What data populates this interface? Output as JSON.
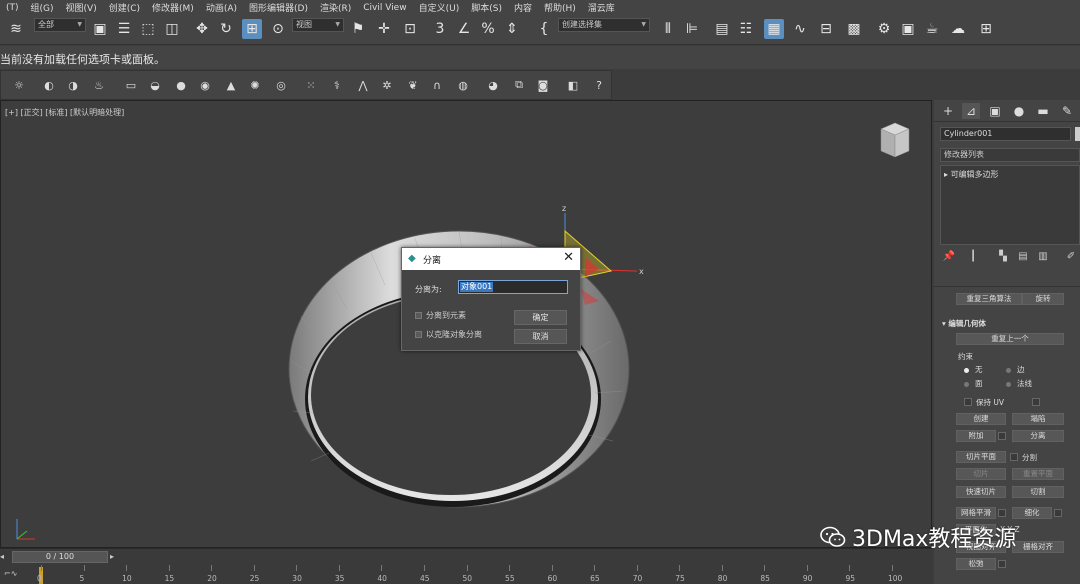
{
  "menu": [
    "(T)",
    "组(G)",
    "视图(V)",
    "创建(C)",
    "修改器(M)",
    "动画(A)",
    "图形编辑器(D)",
    "渲染(R)",
    "Civil View",
    "自定义(U)",
    "脚本(S)",
    "内容",
    "帮助(H)",
    "溜云库"
  ],
  "toolbar": {
    "filter_combo": "全部",
    "viewport_combo": "视图",
    "selection_set_combo": "创建选择集"
  },
  "status_message": "当前没有加载任何选项卡或面板。",
  "viewport": {
    "label": "[+] [正交] [标准] [默认明暗处理]",
    "gizmo_x": "x",
    "gizmo_z": "z"
  },
  "dialog": {
    "title": "分离",
    "detach_as_label": "分离为:",
    "detach_as_value": "对象001",
    "option_element": "分离到元素",
    "option_clone": "以克隆对象分离",
    "ok_label": "确定",
    "cancel_label": "取消"
  },
  "command_panel": {
    "object_name": "Cylinder001",
    "modifier_list": "修改器列表",
    "stack_item": "可编辑多边形",
    "retriangulate": "重复三角算法",
    "rotate": "旋转",
    "section_title": "编辑几何体",
    "repeat_last": "重复上一个",
    "constraints_title": "约束",
    "constraint_none": "无",
    "constraint_edge": "边",
    "constraint_face": "面",
    "constraint_normal": "法线",
    "preserve_uv": "保持 UV",
    "create": "创建",
    "collapse": "塌陷",
    "attach": "附加",
    "detach": "分离",
    "slice_plane": "切片平面",
    "split": "分割",
    "slice": "切片",
    "reset_plane": "重置平面",
    "quickslice": "快速切片",
    "cut": "切割",
    "meshsmooth": "网格平滑",
    "tessellate": "细化",
    "planarize": "平面化",
    "view_align": "视图对齐",
    "grid_align": "栅格对齐",
    "relax": "松弛"
  },
  "timeline": {
    "frame_display": "0 / 100",
    "ticks": [
      "0",
      "5",
      "10",
      "15",
      "20",
      "25",
      "30",
      "35",
      "40",
      "45",
      "50",
      "55",
      "60",
      "65",
      "70",
      "75",
      "80",
      "85",
      "90",
      "95",
      "100"
    ]
  },
  "watermark": "3DMax教程资源"
}
